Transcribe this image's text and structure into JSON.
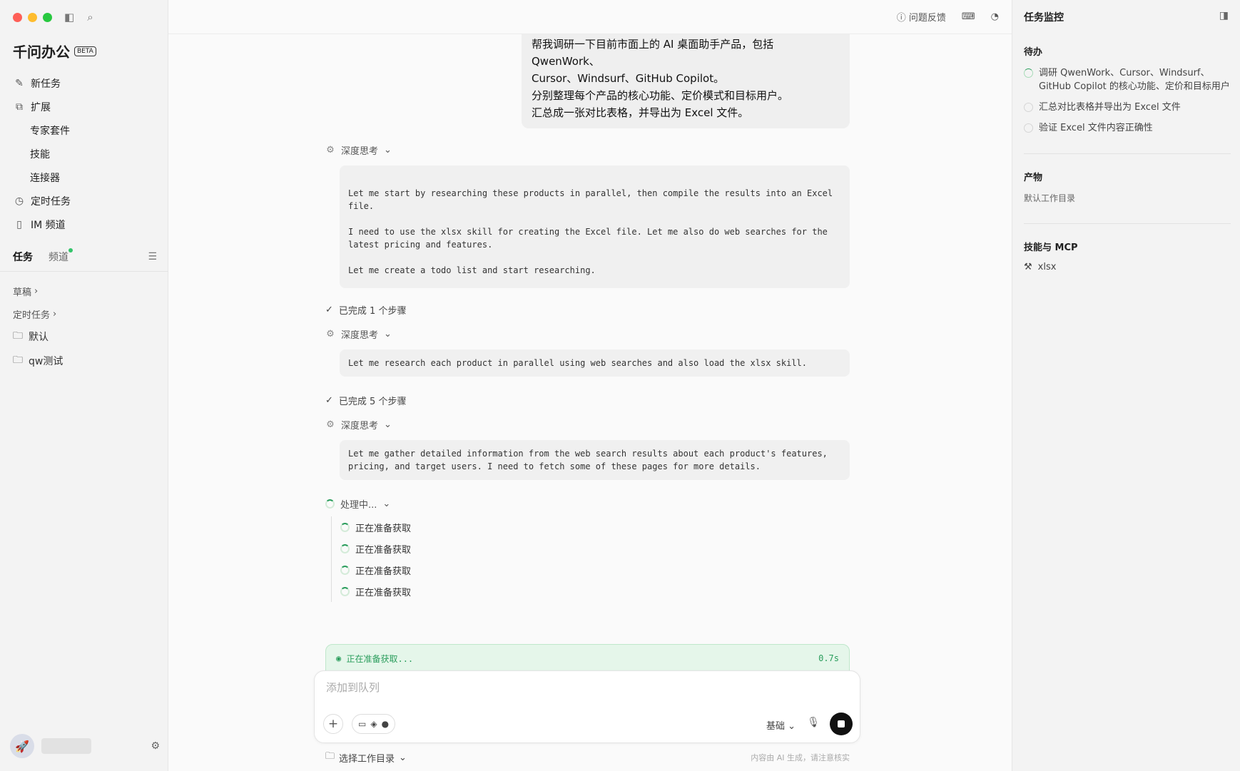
{
  "sidebar": {
    "app_title": "千问办公",
    "beta": "BETA",
    "nav": [
      {
        "label": "新任务",
        "icon": "edit-icon"
      },
      {
        "label": "扩展",
        "icon": "extension-icon"
      },
      {
        "label": "专家套件"
      },
      {
        "label": "技能"
      },
      {
        "label": "连接器"
      },
      {
        "label": "定时任务",
        "icon": "clock-icon"
      },
      {
        "label": "IM 频道",
        "icon": "phone-icon"
      }
    ],
    "tabs": [
      {
        "label": "任务"
      },
      {
        "label": "频道"
      }
    ],
    "groups": {
      "drafts": "草稿",
      "scheduled": "定时任务"
    },
    "folders": [
      {
        "label": "默认"
      },
      {
        "label": "qw测试"
      }
    ]
  },
  "topbar": {
    "feedback": "问题反馈"
  },
  "chat": {
    "user_message": [
      "帮我调研一下目前市面上的 AI 桌面助手产品，包括 QwenWork、",
      "Cursor、Windsurf、GitHub Copilot。",
      "分别整理每个产品的核心功能、定价模式和目标用户。",
      "汇总成一张对比表格，并导出为 Excel 文件。"
    ],
    "think_label": "深度思考",
    "think1": "Let me start by researching these products in parallel, then compile the results into an Excel file.\n\nI need to use the xlsx skill for creating the Excel file. Let me also do web searches for the latest pricing and features.\n\nLet me create a todo list and start researching.",
    "done1": "已完成 1 个步骤",
    "think2": "Let me research each product in parallel using web searches and also load the xlsx skill.",
    "done2": "已完成 5 个步骤",
    "think3": "Let me gather detailed information from the web search results about each product's features, pricing, and target users. I need to fetch some of these pages for more details.",
    "processing": "处理中...",
    "proc_items": [
      "正在准备获取",
      "正在准备获取",
      "正在准备获取",
      "正在准备获取"
    ],
    "status_text": "正在准备获取...",
    "status_time": "0.7s"
  },
  "composer": {
    "placeholder": "添加到队列",
    "mode": "基础",
    "workdir": "选择工作目录",
    "disclaimer": "内容由 AI 生成，请注意核实"
  },
  "rpanel": {
    "title": "任务监控",
    "todo_h": "待办",
    "todos": [
      {
        "text": "调研 QwenWork、Cursor、Windsurf、GitHub Copilot 的核心功能、定价和目标用户"
      },
      {
        "text": "汇总对比表格并导出为 Excel 文件"
      },
      {
        "text": "验证 Excel 文件内容正确性"
      }
    ],
    "artifacts_h": "产物",
    "artifacts_default": "默认工作目录",
    "skills_h": "技能与 MCP",
    "skill": "xlsx"
  },
  "colors": {
    "accent_green": "#2a9d5c",
    "status_bg": "#e5f6ea"
  }
}
